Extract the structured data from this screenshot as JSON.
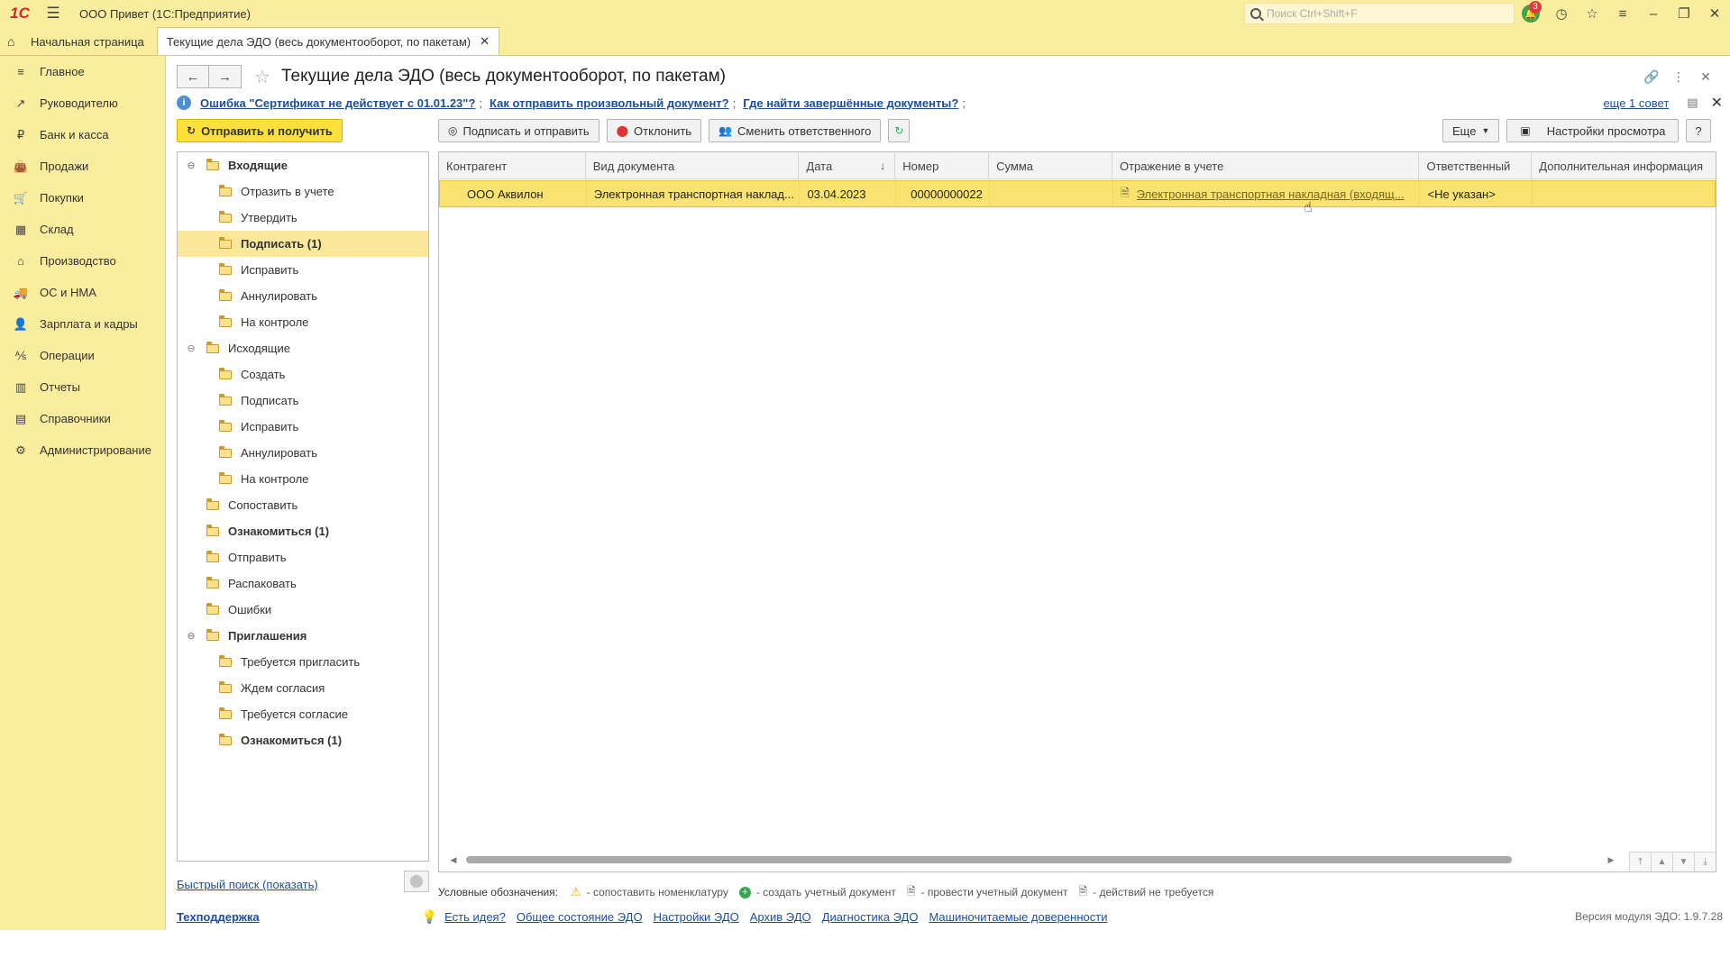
{
  "window": {
    "logo": "1С",
    "title": "ООО Привет  (1С:Предприятие)",
    "search_placeholder": "Поиск Ctrl+Shift+F",
    "notification_count": "3"
  },
  "tabs": {
    "home": "Начальная страница",
    "active": "Текущие дела ЭДО (весь документооборот, по пакетам)"
  },
  "sidebar": {
    "items": [
      {
        "label": "Главное",
        "icon": "menu-icon"
      },
      {
        "label": "Руководителю",
        "icon": "trend-icon"
      },
      {
        "label": "Банк и касса",
        "icon": "coin-icon"
      },
      {
        "label": "Продажи",
        "icon": "bag-icon"
      },
      {
        "label": "Покупки",
        "icon": "cart-icon"
      },
      {
        "label": "Склад",
        "icon": "grid-icon"
      },
      {
        "label": "Производство",
        "icon": "factory-icon"
      },
      {
        "label": "ОС и НМА",
        "icon": "truck-icon"
      },
      {
        "label": "Зарплата и кадры",
        "icon": "person-icon"
      },
      {
        "label": "Операции",
        "icon": "operations-icon"
      },
      {
        "label": "Отчеты",
        "icon": "chart-icon"
      },
      {
        "label": "Справочники",
        "icon": "book-icon"
      },
      {
        "label": "Администрирование",
        "icon": "gear-icon"
      }
    ]
  },
  "page": {
    "title": "Текущие дела ЭДО (весь документооборот, по пакетам)"
  },
  "tips": {
    "link1": "Ошибка \"Сертификат не действует с 01.01.23\"?",
    "link2": "Как отправить произвольный документ?",
    "link3": "Где найти завершённые документы?",
    "separator": ";",
    "more": "еще 1 совет"
  },
  "toolbar": {
    "send_receive": "Отправить и получить",
    "sign_send": "Подписать и отправить",
    "reject": "Отклонить",
    "change_responsible": "Сменить ответственного",
    "more": "Еще",
    "view_settings": "Настройки просмотра",
    "help": "?"
  },
  "tree": [
    {
      "label": "Входящие",
      "level": 0,
      "bold": true,
      "toggle": "⊖"
    },
    {
      "label": "Отразить в учете",
      "level": 1
    },
    {
      "label": "Утвердить",
      "level": 1
    },
    {
      "label": "Подписать (1)",
      "level": 1,
      "bold": true,
      "selected": true
    },
    {
      "label": "Исправить",
      "level": 1
    },
    {
      "label": "Аннулировать",
      "level": 1
    },
    {
      "label": "На контроле",
      "level": 1
    },
    {
      "label": "Исходящие",
      "level": 0,
      "toggle": "⊖"
    },
    {
      "label": "Создать",
      "level": 1
    },
    {
      "label": "Подписать",
      "level": 1
    },
    {
      "label": "Исправить",
      "level": 1
    },
    {
      "label": "Аннулировать",
      "level": 1
    },
    {
      "label": "На контроле",
      "level": 1
    },
    {
      "label": "Сопоставить",
      "level": 0
    },
    {
      "label": "Ознакомиться (1)",
      "level": 0,
      "bold": true
    },
    {
      "label": "Отправить",
      "level": 0
    },
    {
      "label": "Распаковать",
      "level": 0
    },
    {
      "label": "Ошибки",
      "level": 0
    },
    {
      "label": "Приглашения",
      "level": 0,
      "bold": true,
      "toggle": "⊖"
    },
    {
      "label": "Требуется пригласить",
      "level": 1
    },
    {
      "label": "Ждем согласия",
      "level": 1
    },
    {
      "label": "Требуется согласие",
      "level": 1
    },
    {
      "label": "Ознакомиться (1)",
      "level": 1,
      "bold": true
    }
  ],
  "quick_search": "Быстрый поиск (показать)",
  "grid": {
    "columns": [
      "Контрагент",
      "Вид документа",
      "Дата",
      "Номер",
      "Сумма",
      "Отражение в учете",
      "Ответственный",
      "Дополнительная информация"
    ],
    "sort_indicator": "↓",
    "rows": [
      {
        "counterparty": "ООО Аквилон",
        "doc_type": "Электронная транспортная наклад...",
        "date": "03.04.2023",
        "number": "00000000022",
        "sum": "",
        "accounting": "Электронная транспортная накладная (входящ...",
        "responsible": "<Не указан>",
        "extra": ""
      }
    ]
  },
  "legend": {
    "title": "Условные обозначения:",
    "item1": "- сопоставить номенклатуру",
    "item2": "- создать учетный документ",
    "item3": "- провести учетный документ",
    "item4": "- действий не требуется"
  },
  "footer": {
    "support": "Техподдержка",
    "links": [
      "Есть идея?",
      "Общее состояние ЭДО",
      "Настройки ЭДО",
      "Архив ЭДО",
      "Диагностика ЭДО",
      "Машиночитаемые доверенности"
    ],
    "version": "Версия модуля ЭДО: 1.9.7.28"
  },
  "colors": {
    "panel": "#fbed9e",
    "accent_button": "#fce13c",
    "selected_row": "#fbe36f",
    "link": "#1b4f9c"
  }
}
